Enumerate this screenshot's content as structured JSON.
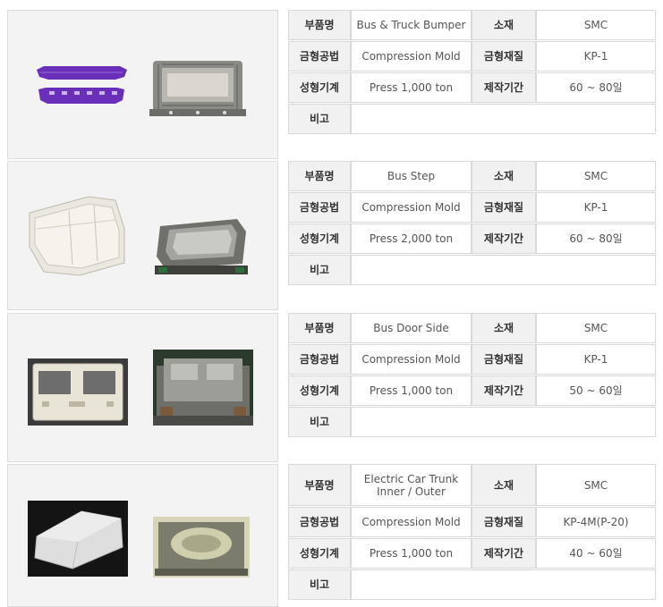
{
  "labels": {
    "part_name": "부품명",
    "material": "소재",
    "mold_method": "금형공법",
    "mold_material": "금형재질",
    "machine": "성형기계",
    "period": "제작기간",
    "remarks": "비고"
  },
  "items": [
    {
      "part_name": "Bus & Truck Bumper",
      "material": "SMC",
      "mold_method": "Compression Mold",
      "mold_material": "KP-1",
      "machine": "Press 1,000 ton",
      "period": "60 ~ 80일",
      "remarks": "",
      "product_icon": "bumper-product-photo",
      "mold_icon": "bumper-mold-photo",
      "accent": "#6a2fb8"
    },
    {
      "part_name": "Bus Step",
      "material": "SMC",
      "mold_method": "Compression Mold",
      "mold_material": "KP-1",
      "machine": "Press 2,000 ton",
      "period": "60 ~ 80일",
      "remarks": "",
      "product_icon": "bus-step-product-photo",
      "mold_icon": "bus-step-mold-photo",
      "accent": "#e9e6dc"
    },
    {
      "part_name": "Bus Door Side",
      "material": "SMC",
      "mold_method": "Compression Mold",
      "mold_material": "KP-1",
      "machine": "Press 1,000 ton",
      "period": "50 ~ 60일",
      "remarks": "",
      "product_icon": "door-side-product-photo",
      "mold_icon": "door-side-mold-photo",
      "accent": "#e4e0d2"
    },
    {
      "part_name_line1": "Electric Car Trunk",
      "part_name_line2": "Inner / Outer",
      "material": "SMC",
      "mold_method": "Compression Mold",
      "mold_material": "KP-4M(P-20)",
      "machine": "Press 1,000 ton",
      "period": "40 ~ 60일",
      "remarks": "",
      "product_icon": "trunk-product-photo",
      "mold_icon": "trunk-mold-photo",
      "accent": "#d8d8d8"
    }
  ]
}
